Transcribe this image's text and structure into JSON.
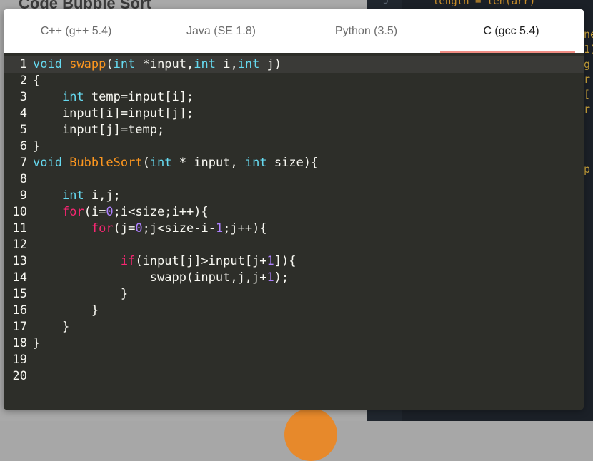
{
  "background": {
    "page_title": "Code Bubble Sort",
    "editor_line_number": "5",
    "editor_code": "length = len(arr)",
    "side_fragments": [
      "ne",
      "1)",
      "g",
      "r",
      "[",
      "r",
      "",
      "",
      "",
      "p"
    ]
  },
  "tabs": [
    {
      "label": "C++ (g++ 5.4)",
      "active": false
    },
    {
      "label": "Java (SE 1.8)",
      "active": false
    },
    {
      "label": "Python (3.5)",
      "active": false
    },
    {
      "label": "C (gcc 5.4)",
      "active": true
    }
  ],
  "colors": {
    "keyword": "#66d9ef",
    "function": "#fd971f",
    "number": "#ae81ff",
    "control": "#f92672",
    "text": "#f8f8f2",
    "editor_bg": "#2d2e29",
    "active_tab_underline": "#f08c83"
  },
  "editor": {
    "current_line": 1,
    "lines": [
      [
        [
          "k",
          "void"
        ],
        [
          "t",
          " "
        ],
        [
          "f",
          "swapp"
        ],
        [
          "t",
          "("
        ],
        [
          "k",
          "int"
        ],
        [
          "t",
          " *input,"
        ],
        [
          "k",
          "int"
        ],
        [
          "t",
          " i,"
        ],
        [
          "k",
          "int"
        ],
        [
          "t",
          " j)"
        ]
      ],
      [
        [
          "t",
          "{"
        ]
      ],
      [
        [
          "t",
          "    "
        ],
        [
          "k",
          "int"
        ],
        [
          "t",
          " temp=input[i];"
        ]
      ],
      [
        [
          "t",
          "    input[i]=input[j];"
        ]
      ],
      [
        [
          "t",
          "    input[j]=temp;"
        ]
      ],
      [
        [
          "t",
          "}"
        ]
      ],
      [
        [
          "k",
          "void"
        ],
        [
          "t",
          " "
        ],
        [
          "f",
          "BubbleSort"
        ],
        [
          "t",
          "("
        ],
        [
          "k",
          "int"
        ],
        [
          "t",
          " * input, "
        ],
        [
          "k",
          "int"
        ],
        [
          "t",
          " size){"
        ]
      ],
      [],
      [
        [
          "t",
          "    "
        ],
        [
          "k",
          "int"
        ],
        [
          "t",
          " i,j;"
        ]
      ],
      [
        [
          "t",
          "    "
        ],
        [
          "r",
          "for"
        ],
        [
          "t",
          "(i="
        ],
        [
          "n",
          "0"
        ],
        [
          "t",
          ";i<size;i++){"
        ]
      ],
      [
        [
          "t",
          "        "
        ],
        [
          "r",
          "for"
        ],
        [
          "t",
          "(j="
        ],
        [
          "n",
          "0"
        ],
        [
          "t",
          ";j<size-i-"
        ],
        [
          "n",
          "1"
        ],
        [
          "t",
          ";j++){"
        ]
      ],
      [],
      [
        [
          "t",
          "            "
        ],
        [
          "r",
          "if"
        ],
        [
          "t",
          "(input[j]>input[j+"
        ],
        [
          "n",
          "1"
        ],
        [
          "t",
          "]){"
        ]
      ],
      [
        [
          "t",
          "                swapp(input,j,j+"
        ],
        [
          "n",
          "1"
        ],
        [
          "t",
          ");"
        ]
      ],
      [
        [
          "t",
          "            }"
        ]
      ],
      [
        [
          "t",
          "        }"
        ]
      ],
      [
        [
          "t",
          "    }"
        ]
      ],
      [
        [
          "t",
          "}"
        ]
      ],
      [],
      []
    ]
  }
}
